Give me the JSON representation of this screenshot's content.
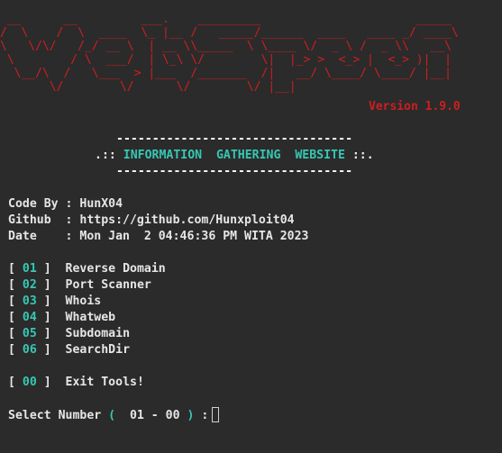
{
  "banner": {
    "art_lines": [
      " __      __         ___.    _________                      _____ ",
      "/  \\    /  \\  ____  \\_ |__ /   _____/______  ____   ____ _/ ____\\",
      "\\   \\/\\/   /_/ __ \\  | __ \\\\_____  \\ \\____ \\/  _ \\ /  _ \\\\   __\\ ",
      " \\        / \\  ___/  | \\_\\ \\/        \\|  |_> >  <_> |  <_> )|  |   ",
      "  \\__/\\  /   \\___  > |___  /_______  /|   __/ \\____/ \\____/ |__|   ",
      "       \\/        \\/      \\/        \\/ |__|                         "
    ],
    "version": "Version 1.9.0"
  },
  "header": {
    "rule": "---------------------------------",
    "prefix": ".:: ",
    "title": "INFORMATION  GATHERING  WEBSITE",
    "suffix": " ::."
  },
  "info": {
    "code_by_label": "Code By",
    "code_by_sep": " : ",
    "code_by_value": "HunX04",
    "github_label": "Github ",
    "github_sep": " : ",
    "github_value": "https://github.com/Hunxploit04",
    "date_label": "Date   ",
    "date_sep": " : ",
    "date_value": "Mon Jan  2 04:46:36 PM WITA 2023"
  },
  "menu": {
    "items": [
      {
        "num": "01",
        "label": "Reverse Domain"
      },
      {
        "num": "02",
        "label": "Port Scanner"
      },
      {
        "num": "03",
        "label": "Whois"
      },
      {
        "num": "04",
        "label": "Whatweb"
      },
      {
        "num": "05",
        "label": "Subdomain"
      },
      {
        "num": "06",
        "label": "SearchDir"
      }
    ],
    "exit": {
      "num": "00",
      "label": "Exit Tools!"
    },
    "bracket_open": "[ ",
    "bracket_close": " ]  "
  },
  "prompt": {
    "label": "Select Number ",
    "paren_open": "(",
    "range": "  01 - 00 ",
    "paren_close": ")",
    "colon": " :"
  },
  "colors": {
    "background": "#2b2b2b",
    "banner": "#d01e1e",
    "accent": "#36c8b4",
    "text": "#e6e6e6"
  }
}
